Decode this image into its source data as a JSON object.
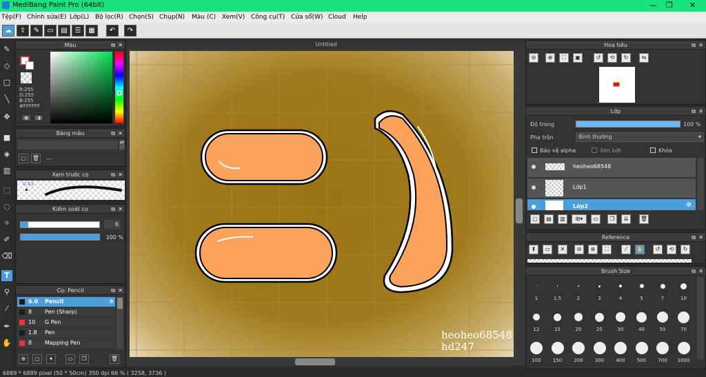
{
  "titlebar": {
    "title": "MediBang Paint Pro (64bit)",
    "minimize": "—",
    "restore": "❐",
    "close": "✕"
  },
  "menu": [
    "Tệp(F)",
    "Chỉnh sửa(E)",
    "Lớp(L)",
    "Bộ lọc(R)",
    "Chọn(S)",
    "Chụp(N)",
    "Màu (C)",
    "Xem(V)",
    "Công cụ(T)",
    "Cửa sổ(W)",
    "Cloud",
    "Help"
  ],
  "document": {
    "tab_title": "Untitled",
    "signature_line1": "heoheo68548",
    "signature_line2": "hd247"
  },
  "color_panel": {
    "title": "Màu",
    "r": "R:255",
    "g": "G:255",
    "b": "B:255",
    "hex": "#FFFFFF"
  },
  "palette_panel": {
    "title": "Bảng màu",
    "entry": "---"
  },
  "brush_preview": {
    "title": "Xem trước cọ",
    "size": "0.43"
  },
  "brush_control": {
    "title": "Kiểm soát cọ",
    "size_value": "6",
    "opacity_value": "100 %"
  },
  "brush_list": {
    "title": "Cọ: Pencil",
    "items": [
      {
        "size": "6.0",
        "name": "Pencil",
        "color": "#1a1a1a",
        "selected": true
      },
      {
        "size": "8",
        "name": "Pen (Sharp)",
        "color": "#1a1a1a",
        "selected": false
      },
      {
        "size": "10",
        "name": "G Pen",
        "color": "#e53935",
        "selected": false
      },
      {
        "size": "1.8",
        "name": "Pen",
        "color": "#1a1a1a",
        "selected": false
      },
      {
        "size": "8",
        "name": "Mapping Pen",
        "color": "#e53935",
        "selected": false
      }
    ]
  },
  "navigator": {
    "title": "Hoa tiêu"
  },
  "layer_panel": {
    "title": "Lớp",
    "opacity_label": "Độ trong",
    "opacity_value": "100 %",
    "blend_label": "Pha trộn",
    "blend_value": "Bình thường",
    "protect_alpha": "Bảo vệ alpha",
    "clipping": "Xén bớt",
    "lock": "Khóa",
    "layers": [
      {
        "name": "heoheo68548",
        "selected": false
      },
      {
        "name": "Lớp1",
        "selected": false
      },
      {
        "name": "Lớp2",
        "selected": true
      }
    ]
  },
  "reference": {
    "title": "Reference"
  },
  "brush_size": {
    "title": "Brush Size",
    "sizes": [
      "1",
      "1.5",
      "2",
      "3",
      "4",
      "5",
      "7",
      "10",
      "12",
      "15",
      "20",
      "25",
      "30",
      "40",
      "50",
      "70",
      "100",
      "150",
      "200",
      "300",
      "400",
      "500",
      "700",
      "1000"
    ]
  },
  "status": {
    "text": "6889 * 6889 pixel   (50 * 50cm)   350 dpi   66 %   ( 3258, 3736 )"
  },
  "colors": {
    "accent": "#4a9fdc",
    "canvas_bg": "#a07a1c",
    "shape_fill": "#fba35c",
    "titlebar": "#19e27f"
  }
}
